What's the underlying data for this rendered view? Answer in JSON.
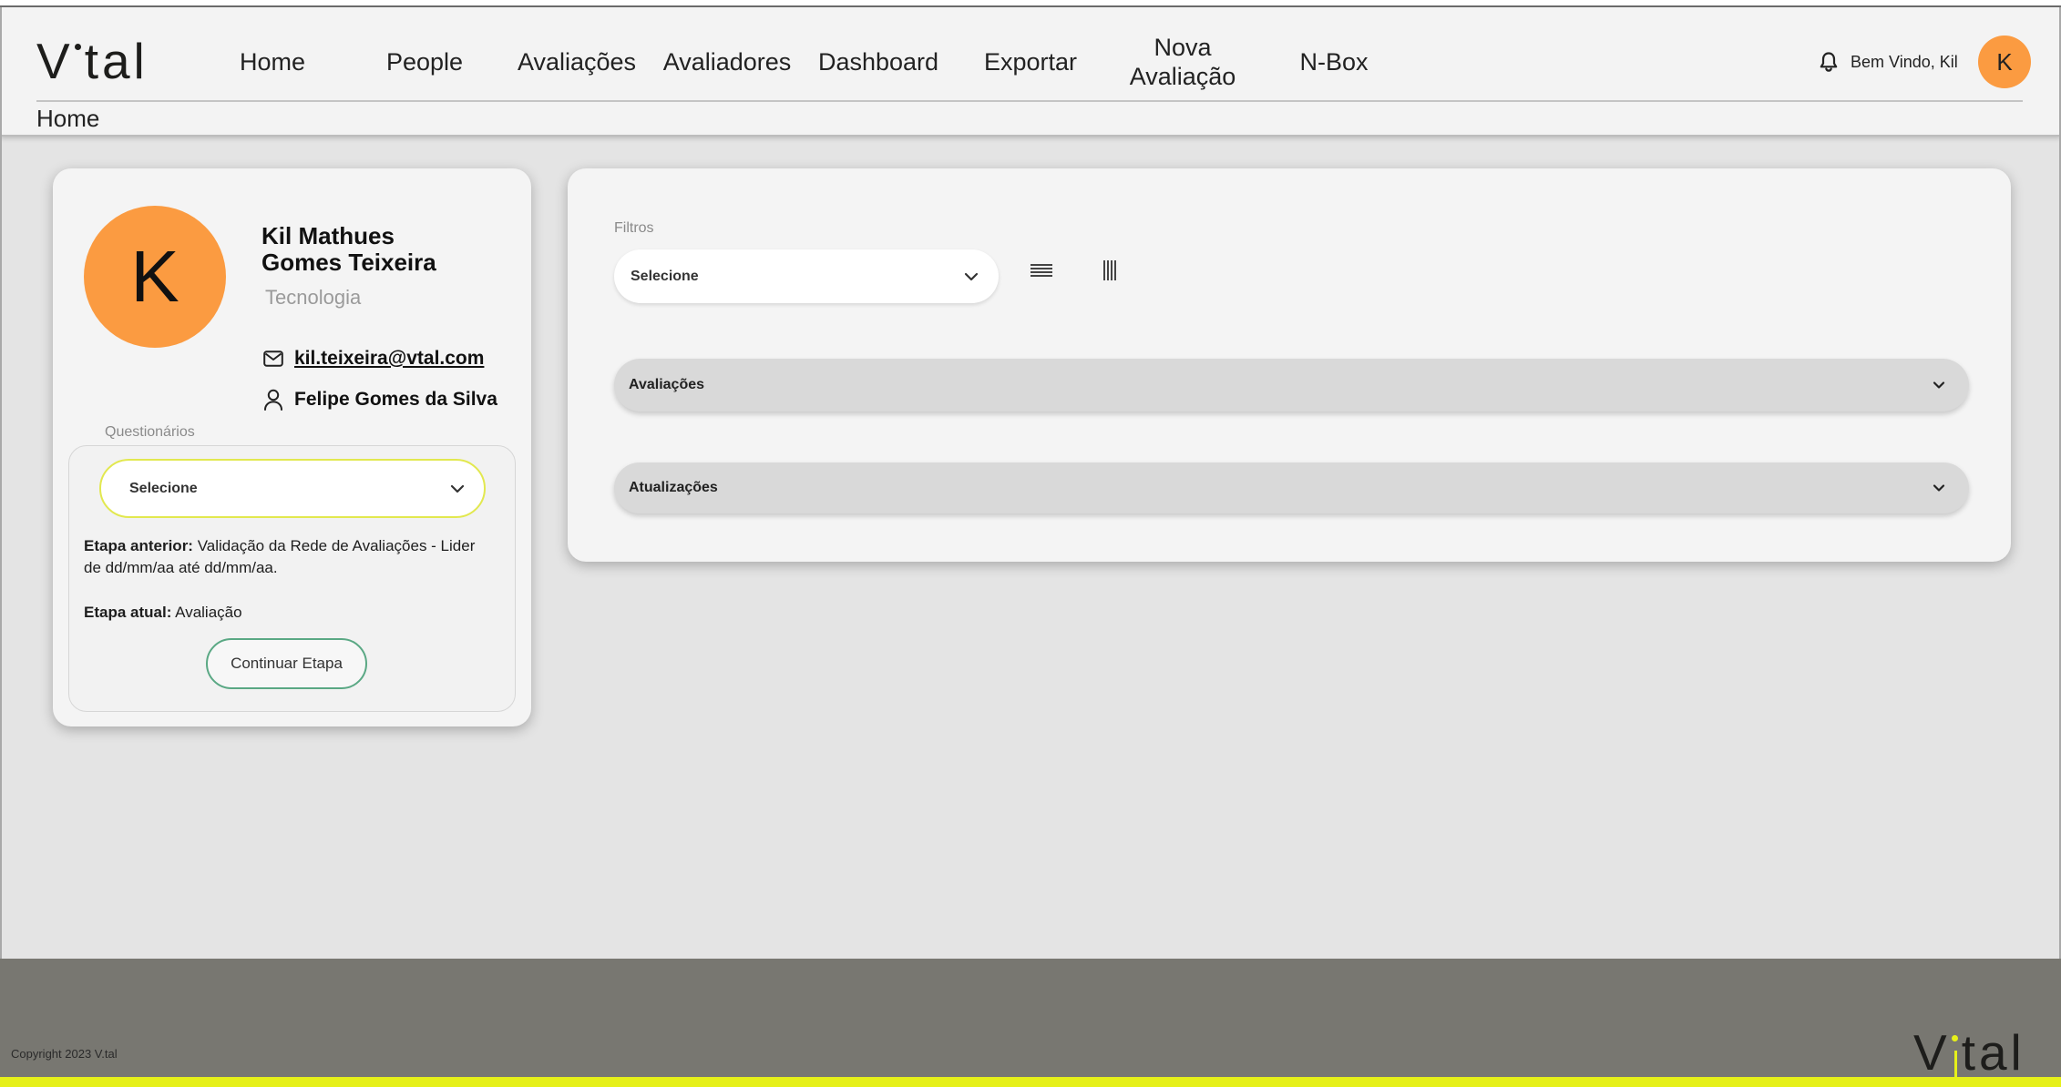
{
  "brand": {
    "part1": "V",
    "part2": "tal"
  },
  "nav": {
    "items": [
      {
        "label": "Home"
      },
      {
        "label": "People"
      },
      {
        "label": "Avaliações"
      },
      {
        "label": "Avaliadores"
      },
      {
        "label": "Dashboard"
      },
      {
        "label": "Exportar"
      },
      {
        "label": "Nova Avaliação"
      },
      {
        "label": "N-Box"
      }
    ]
  },
  "user_menu": {
    "notification_icon": "bell-icon",
    "welcome": "Bem Vindo, Kil",
    "avatar_initial": "K"
  },
  "breadcrumb": {
    "current": "Home"
  },
  "profile": {
    "avatar_initial": "K",
    "name": "Kil Mathues Gomes Teixeira",
    "department": "Tecnologia",
    "email_icon": "mail-icon",
    "email": "kil.teixeira@vtal.com",
    "manager_icon": "person-icon",
    "manager": "Felipe Gomes da Silva"
  },
  "questionnaires": {
    "label": "Questionários",
    "select": {
      "value": "Selecione",
      "icon": "chevron-down-icon"
    },
    "previous_step": {
      "label": "Etapa anterior:",
      "text": "Validação da Rede de Avaliações - Lider de dd/mm/aa até dd/mm/aa."
    },
    "current_step": {
      "label": "Etapa atual:",
      "text": "Avaliação"
    },
    "continue_button": "Continuar Etapa"
  },
  "filters": {
    "label": "Filtros",
    "select": {
      "value": "Selecione",
      "icon": "chevron-down-icon"
    },
    "view_toggle_icons": [
      "list-view-icon",
      "column-view-icon"
    ]
  },
  "accordions": [
    {
      "title": "Avaliações",
      "icon": "chevron-down-icon"
    },
    {
      "title": "Atualizações",
      "icon": "chevron-down-icon"
    }
  ],
  "footer": {
    "copyright": "Copyright 2023 V.tal"
  },
  "colors": {
    "accent_orange": "#fb9b41",
    "select_border_yellow": "#e2e84f",
    "button_border_green": "#5aa884",
    "footer_bg": "#787771",
    "footer_stripe_yellow": "#e6f01a",
    "page_bg": "#e4e4e4",
    "card_bg": "#f4f4f4",
    "accordion_bg": "#d9d9d9",
    "header_bg": "#f3f3f3"
  }
}
